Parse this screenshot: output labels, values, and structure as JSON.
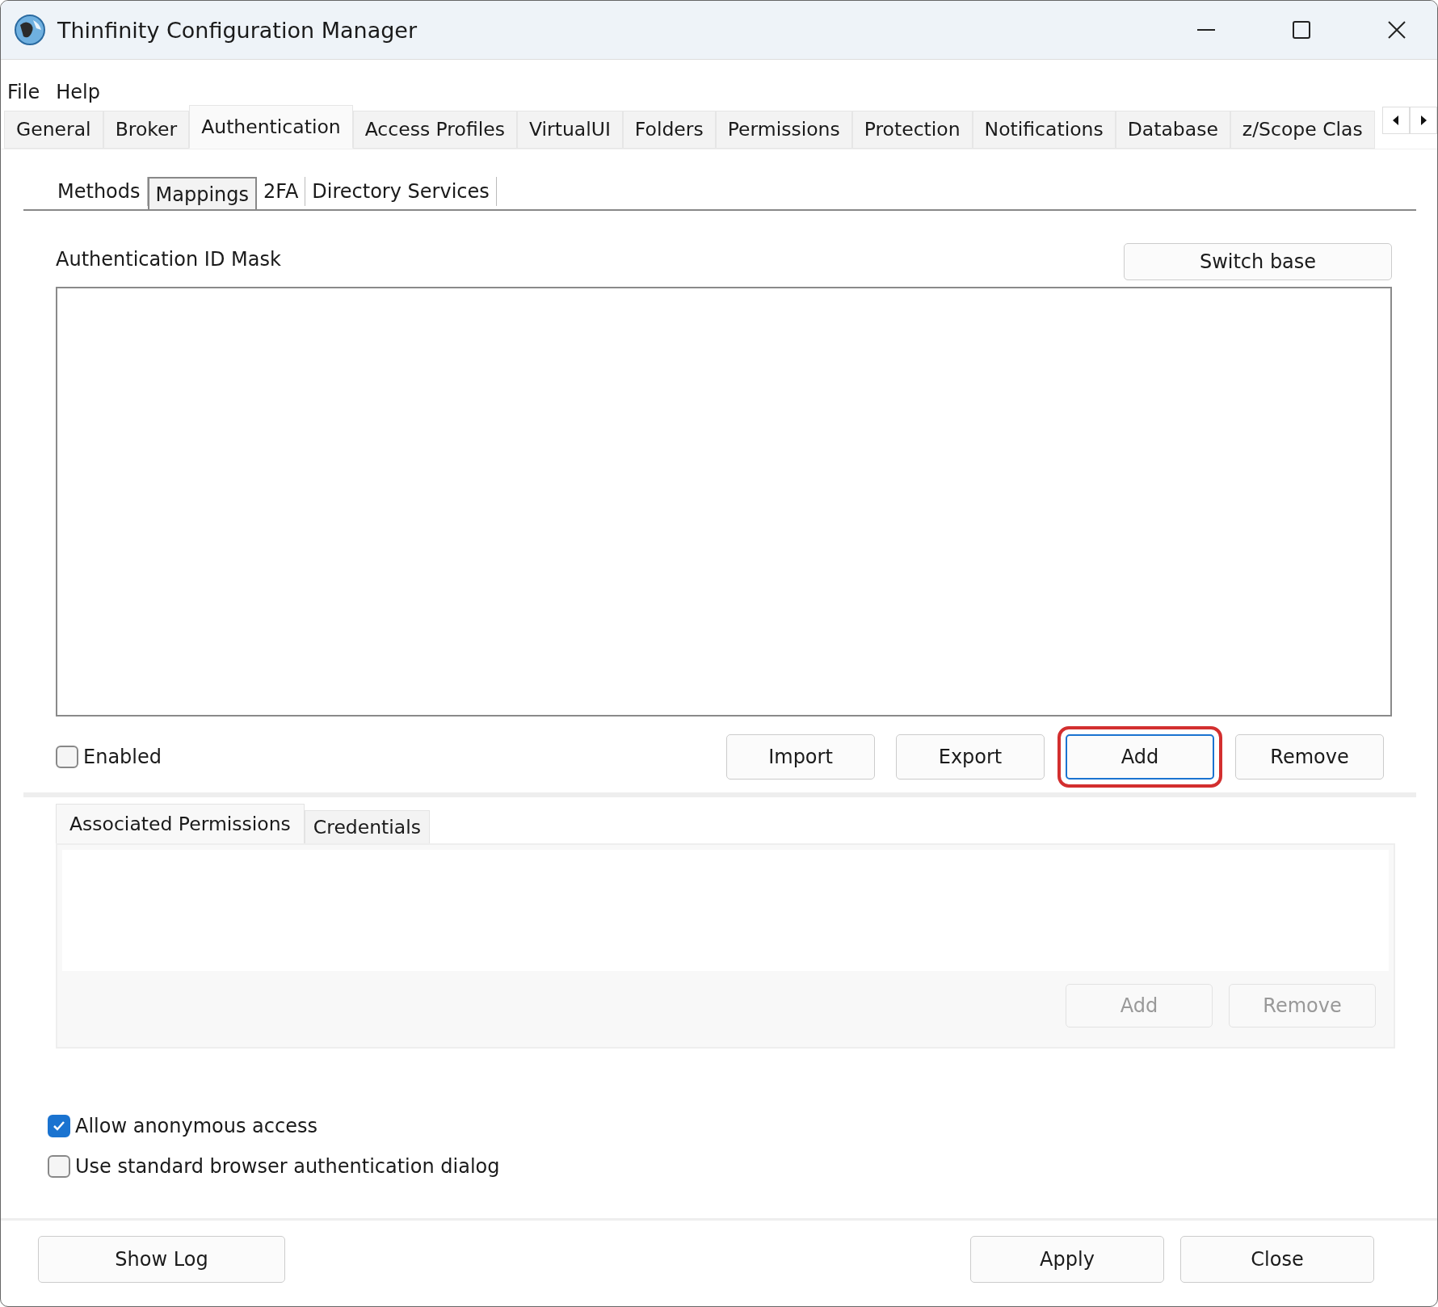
{
  "window": {
    "title": "Thinfinity Configuration Manager"
  },
  "menu": [
    "File",
    "Help"
  ],
  "tabs": [
    {
      "label": "General",
      "selected": false
    },
    {
      "label": "Broker",
      "selected": false
    },
    {
      "label": "Authentication",
      "selected": true
    },
    {
      "label": "Access Profiles",
      "selected": false
    },
    {
      "label": "VirtualUI",
      "selected": false
    },
    {
      "label": "Folders",
      "selected": false
    },
    {
      "label": "Permissions",
      "selected": false
    },
    {
      "label": "Protection",
      "selected": false
    },
    {
      "label": "Notifications",
      "selected": false
    },
    {
      "label": "Database",
      "selected": false
    },
    {
      "label": "z/Scope Clas",
      "selected": false
    }
  ],
  "subtabs": [
    {
      "label": "Methods",
      "selected": false
    },
    {
      "label": "Mappings",
      "selected": true
    },
    {
      "label": "2FA",
      "selected": false
    },
    {
      "label": "Directory Services",
      "selected": false
    }
  ],
  "mappings": {
    "label": "Authentication ID Mask",
    "switch_button": "Switch base",
    "enabled": {
      "label": "Enabled",
      "checked": false
    },
    "buttons": [
      {
        "label": "Import",
        "highlighted": false
      },
      {
        "label": "Export",
        "highlighted": false
      },
      {
        "label": "Add",
        "highlighted": true
      },
      {
        "label": "Remove",
        "highlighted": false
      }
    ]
  },
  "detail_tabs": [
    {
      "label": "Associated Permissions",
      "selected": true
    },
    {
      "label": "Credentials",
      "selected": false
    }
  ],
  "detail_buttons": [
    {
      "label": "Add",
      "disabled": true
    },
    {
      "label": "Remove",
      "disabled": true
    }
  ],
  "options": [
    {
      "label": "Allow anonymous access",
      "checked": true
    },
    {
      "label": "Use standard browser authentication dialog",
      "checked": false
    }
  ],
  "footer": {
    "left": [
      "Show Log"
    ],
    "right": [
      "Apply",
      "Close"
    ]
  }
}
